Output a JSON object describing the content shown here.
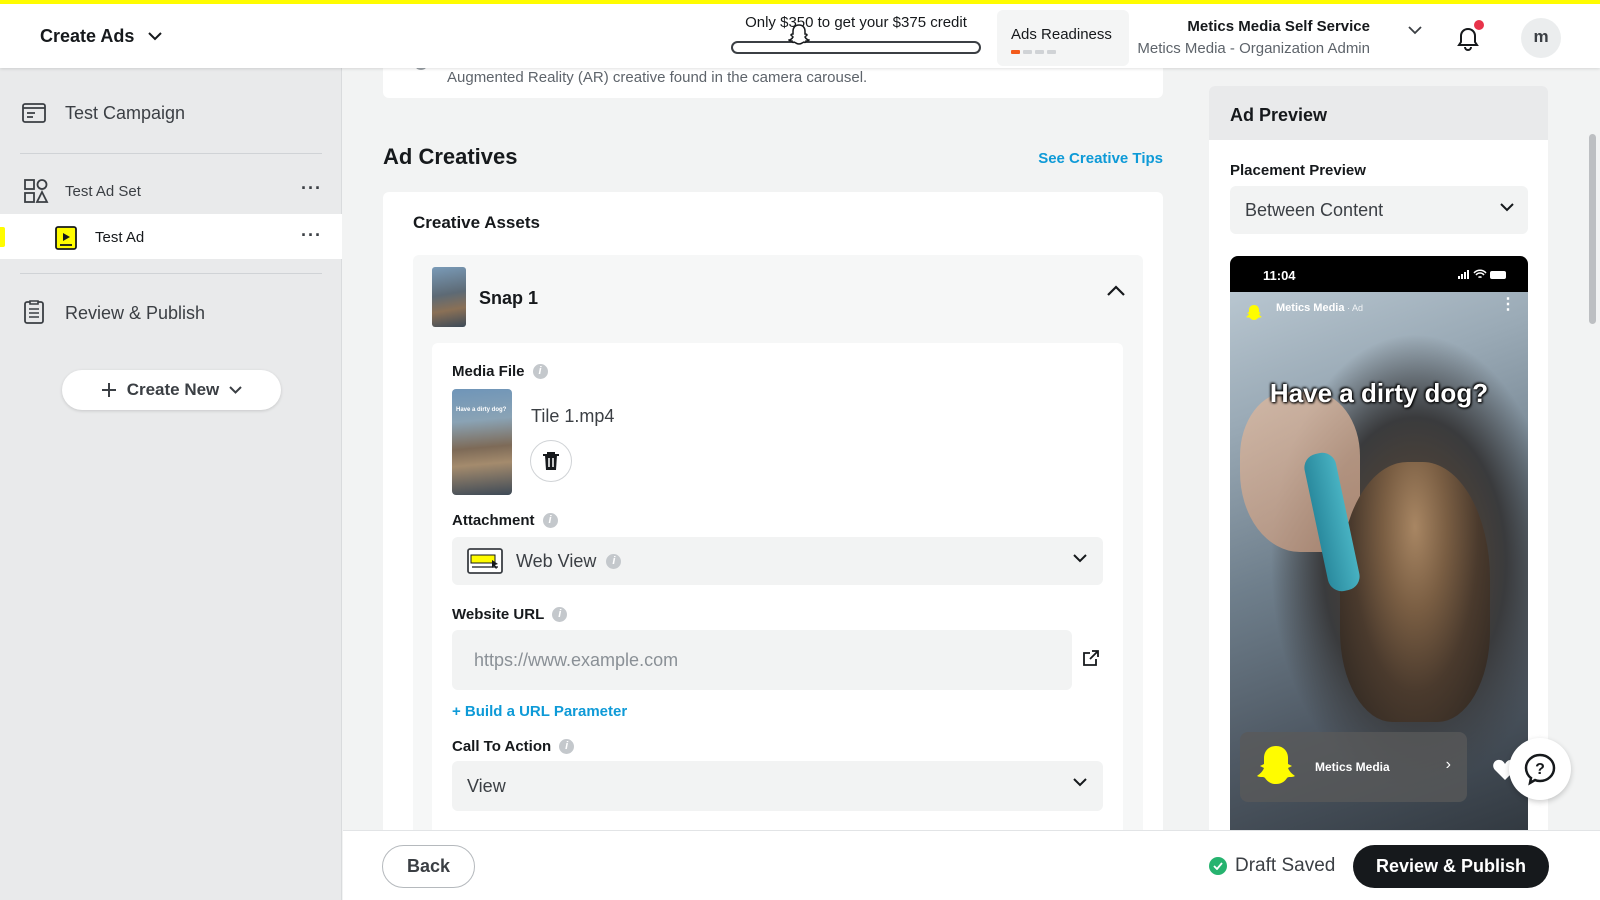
{
  "header": {
    "title": "Create Ads",
    "credit_text": "Only $350 to get your $375 credit",
    "credit_progress": 0.0,
    "readiness_label": "Ads Readiness",
    "readiness_steps_complete": 1,
    "readiness_steps_total": 4,
    "org_name": "Metics Media Self Service",
    "org_role": "Metics Media - Organization Admin",
    "avatar_initial": "m",
    "notification_dot": true
  },
  "sidebar": {
    "campaign": "Test Campaign",
    "ad_set": "Test Ad Set",
    "ad": "Test Ad",
    "review": "Review & Publish",
    "create_new": "Create New",
    "more_label": "···"
  },
  "main": {
    "prev_option_text": "Augmented Reality (AR) creative found in the camera carousel.",
    "section_title": "Ad Creatives",
    "tips_link": "See Creative Tips",
    "assets_title": "Creative Assets",
    "snap_title": "Snap 1",
    "media_file_label": "Media File",
    "file_name": "Tile 1.mp4",
    "thumb_caption": "Have a dirty dog?",
    "attachment_label": "Attachment",
    "attachment_value": "Web View",
    "website_url_label": "Website URL",
    "website_url_placeholder": "https://www.example.com",
    "website_url_value": "",
    "build_param_link": "+ Build a URL Parameter",
    "cta_label": "Call To Action",
    "cta_value": "View"
  },
  "preview": {
    "title": "Ad Preview",
    "placement_label": "Placement Preview",
    "placement_value": "Between Content",
    "phone_time": "11:04",
    "account_name": "Metics Media",
    "account_tag": " · Ad",
    "headline": "Have a dirty dog?",
    "cta_name": "Metics Media"
  },
  "footer": {
    "back": "Back",
    "draft_status": "Draft Saved",
    "publish": "Review & Publish"
  },
  "colors": {
    "snap_yellow": "#fffc00",
    "link_blue": "#0e9ad7",
    "readiness_orange": "#f35b1c",
    "success_green": "#26b36f",
    "notification_red": "#e8334a"
  }
}
